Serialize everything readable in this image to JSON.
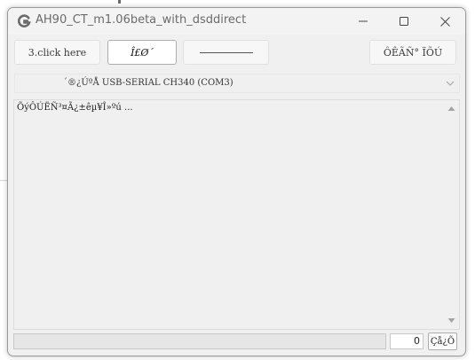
{
  "window": {
    "title": "AH90_CT_m1.06beta_with_dsddirect",
    "icon": "g-logo-icon"
  },
  "toolbar": {
    "button1_label": "3.click here",
    "button2_label": "Î£Ø´",
    "button3_label": "",
    "button4_label": "ÔÊÃÑ° ÏÕÚ"
  },
  "port": {
    "selected": "´®¿ÚºÅ USB-SERIAL CH340 (COM3)"
  },
  "log": {
    "text": "ÕýÔÚËÑ³¤Ã¿±êµ¥Î»ºú ..."
  },
  "status": {
    "message": "",
    "count": "0",
    "button_label": "Çå¿Õ"
  },
  "colors": {
    "window_bg": "#f0f0f0",
    "title_text": "#6b6b6b",
    "border": "#9a9a9a"
  }
}
